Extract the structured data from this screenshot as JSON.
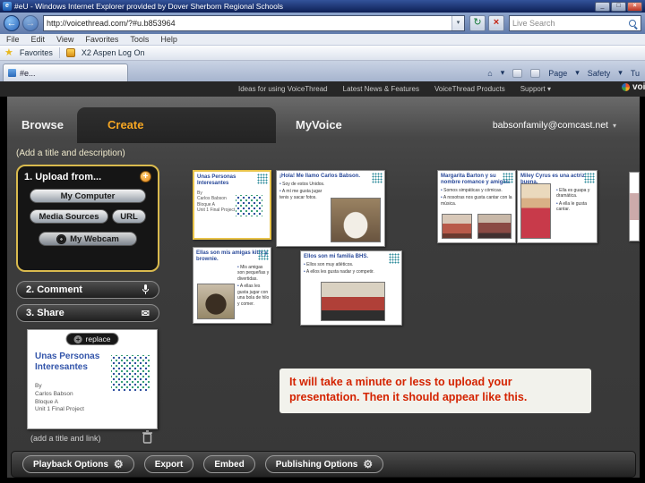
{
  "browser": {
    "title": "#eU - Windows Internet Explorer provided by Dover Sherborn Regional Schools",
    "url": "http://voicethread.com/?#u.b853964",
    "search_value": "Live Search",
    "menu_items": [
      "File",
      "Edit",
      "View",
      "Favorites",
      "Tools",
      "Help"
    ],
    "favorites_label": "Favorites",
    "favorites_link": "X2 Aspen Log On",
    "tab_label": "#e...",
    "command_bar": {
      "page": "Page",
      "safety": "Safety",
      "tools": "Tu"
    }
  },
  "vt_nav": {
    "links": [
      "Ideas for using VoiceThread",
      "Latest News & Features",
      "VoiceThread Products",
      "Support"
    ],
    "logo": "voicethread"
  },
  "app": {
    "tabs": {
      "browse": "Browse",
      "create": "Create",
      "myvoice": "MyVoice"
    },
    "account": "babsonfamily@comcast.net",
    "title_hint": "(Add a title and description)",
    "upload": {
      "step1": "1. Upload from...",
      "my_computer": "My Computer",
      "media_sources": "Media Sources",
      "url": "URL",
      "my_webcam": "My Webcam"
    },
    "step2": "2. Comment",
    "step3": "3. Share",
    "slides": [
      {
        "title": "Unas Personas Interesantes",
        "by": "By",
        "line1": "Carlos Babson",
        "line2": "Bloque A",
        "line3": "Unit 1 Final Project"
      },
      {
        "title": "¡Hola! Me llamo Carlos Babson.",
        "bullets": [
          "Soy de estos Unidos.",
          "A mí me gusta jugar tenis y sacar fotos."
        ]
      },
      {
        "title": "Margarita Barton y su nombre romance y amigas.",
        "bullets": [
          "Somos simpáticas y cómicas.",
          "A nosotras nos gusta cantar con la música."
        ]
      },
      {
        "title": "Miley Cyrus es una actriz buena.",
        "bullets": [
          "Ella es guapa y dramática.",
          "A ella le gusta cantar."
        ]
      },
      {
        "title": "Ellas son mis amigas kitty y brownie.",
        "bullets": [
          "Mis amigas son pequeñas y divertidas.",
          "A ellas les gusta jugar con una bola de hilo y comer."
        ]
      },
      {
        "title": "Ellos son mi familia BHS.",
        "bullets": [
          "Ellos son muy atléticos.",
          "A ellos les gusta nadar y competir."
        ]
      }
    ],
    "preview": {
      "replace": "replace",
      "title": "Unas Personas Interesantes",
      "by": "By",
      "line1": "Carlos Babson",
      "line2": "Bloque A",
      "line3": "Unit 1 Final Project",
      "add_hint": "(add a title and link)"
    },
    "message": "It will take a minute or less to upload your presentation. Then it should appear like this.",
    "bottom": {
      "playback": "Playback Options",
      "export": "Export",
      "embed": "Embed",
      "publishing": "Publishing Options"
    }
  },
  "icons": {
    "back": "←",
    "forward": "→",
    "chevron": "▾",
    "refresh": "↻",
    "stop": "×",
    "star": "★",
    "home": "⌂",
    "gear": "⚙",
    "envelope": "✉",
    "plus": "+",
    "minimize": "_",
    "maximize": "□",
    "close": "×"
  },
  "colors": {
    "accent_orange": "#f5a623",
    "selected_yellow": "#e8c34a",
    "message_red": "#d42300"
  }
}
